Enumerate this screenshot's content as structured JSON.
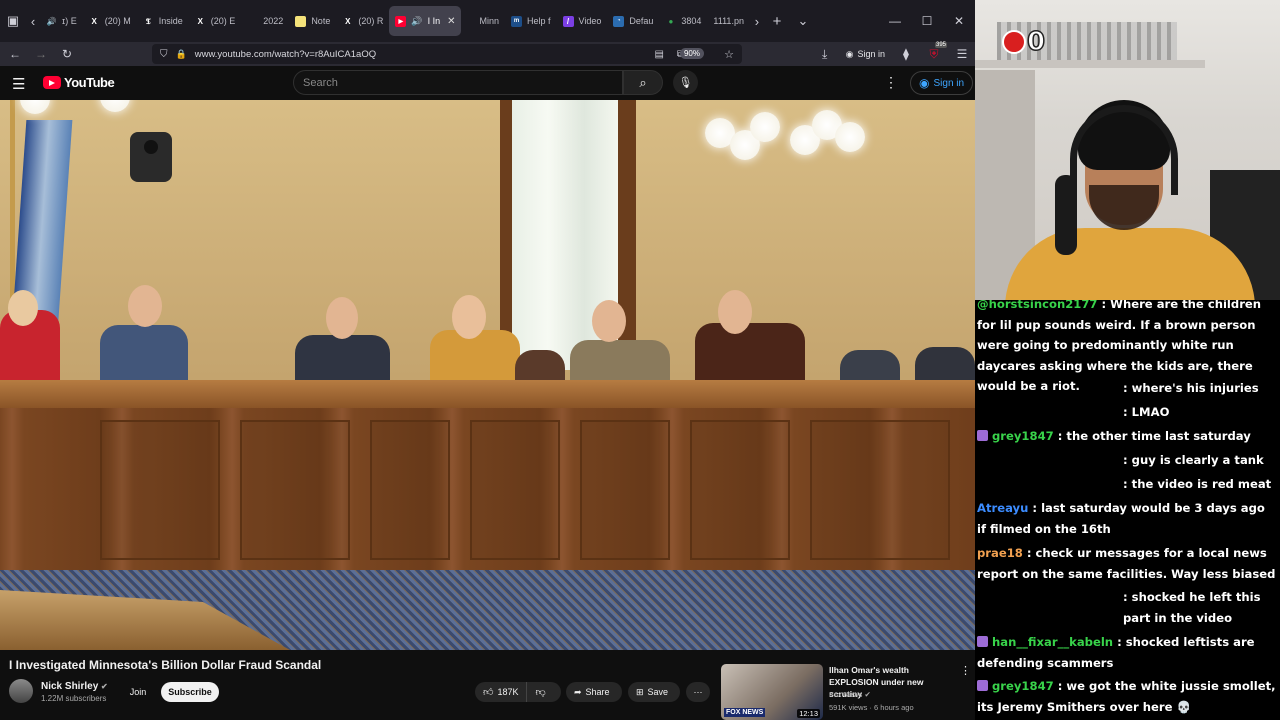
{
  "browser": {
    "tabs": [
      {
        "label": "ɪ) E",
        "icon": "speaker-icon",
        "active": false
      },
      {
        "label": "(20) M",
        "icon": "x-logo-icon",
        "active": false
      },
      {
        "label": "Inside",
        "icon": "nyt-logo-icon",
        "active": false
      },
      {
        "label": "(20) E",
        "icon": "x-logo-icon",
        "active": false
      },
      {
        "label": "2022",
        "icon": "page-icon",
        "active": false
      },
      {
        "label": "Note",
        "icon": "note-icon",
        "active": false
      },
      {
        "label": "(20) R",
        "icon": "x-logo-icon",
        "active": false
      },
      {
        "label": "I In",
        "icon": "youtube-icon",
        "active": true
      },
      {
        "label": "Minn",
        "icon": "page-icon",
        "active": false
      },
      {
        "label": "Help f",
        "icon": "mn-logo-icon",
        "active": false
      },
      {
        "label": "Video",
        "icon": "video-icon",
        "active": false
      },
      {
        "label": "Defau",
        "icon": "page-icon",
        "active": false
      },
      {
        "label": "3804",
        "icon": "maps-pin-icon",
        "active": false
      },
      {
        "label": "1111.pn",
        "icon": "image-icon",
        "active": false
      }
    ],
    "url": "www.youtube.com/watch?v=r8AuICA1aOQ",
    "zoom": "90%",
    "sign_in": "Sign in",
    "notification_count": "395"
  },
  "youtube": {
    "logo_text": "YouTube",
    "search_placeholder": "Search",
    "sign_in": "Sign in",
    "video": {
      "title": "I Investigated Minnesota's Billion Dollar Fraud Scandal",
      "channel": "Nick Shirley",
      "subscribers": "1.22M subscribers",
      "join": "Join",
      "subscribe": "Subscribe",
      "likes": "187K",
      "share": "Share",
      "save": "Save"
    },
    "recommended": {
      "title": "Ilhan Omar's wealth EXPLOSION under new scrutiny",
      "channel": "Fox News",
      "meta": "591K views · 6 hours ago",
      "duration": "12:13",
      "thumb_logo": "FOX NEWS"
    }
  },
  "webcam": {
    "counter": "0"
  },
  "chat": {
    "messages": [
      {
        "user": "@horstsincon2177",
        "text": ": Where are the children for lil pup sounds weird. If a brown person were going to predominantly white run daycares asking where the kids are, there would be a riot.",
        "color": "green",
        "badge": false,
        "indent": false
      },
      {
        "user": "",
        "text": ": where's his injuries",
        "color": "green",
        "badge": false,
        "indent": true
      },
      {
        "user": "",
        "text": ": LMAO",
        "color": "green",
        "badge": false,
        "indent": true
      },
      {
        "user": "grey1847",
        "text": ": the other time last saturday",
        "color": "green",
        "badge": true,
        "indent": false
      },
      {
        "user": "",
        "text": ": guy is clearly a tank",
        "color": "green",
        "badge": false,
        "indent": true
      },
      {
        "user": "",
        "text": ": the video is red meat",
        "color": "green",
        "badge": false,
        "indent": true
      },
      {
        "user": "Atreayu",
        "text": ": last saturday would be 3 days ago if filmed on the 16th",
        "color": "blue",
        "badge": false,
        "indent": false
      },
      {
        "user": "prae18",
        "text": ": check ur messages for a local news report on the same facilities. Way less biased",
        "color": "orange",
        "badge": false,
        "indent": false
      },
      {
        "user": "",
        "text": ": shocked he left this part in the video",
        "color": "green",
        "badge": false,
        "indent": true
      },
      {
        "user": "han__fixar__kabeln",
        "text": ": shocked leftists are defending scammers",
        "color": "green",
        "badge": true,
        "indent": false
      },
      {
        "user": "grey1847",
        "text": ": we got the white jussie smollet, its Jeremy Smithers over here 💀",
        "color": "green",
        "badge": true,
        "indent": false
      }
    ]
  },
  "colors": {
    "yt_red": "#ff0033",
    "yt_link_blue": "#3ea6ff",
    "chat_green": "#38d34a",
    "browser_chrome": "#1c1b22"
  }
}
